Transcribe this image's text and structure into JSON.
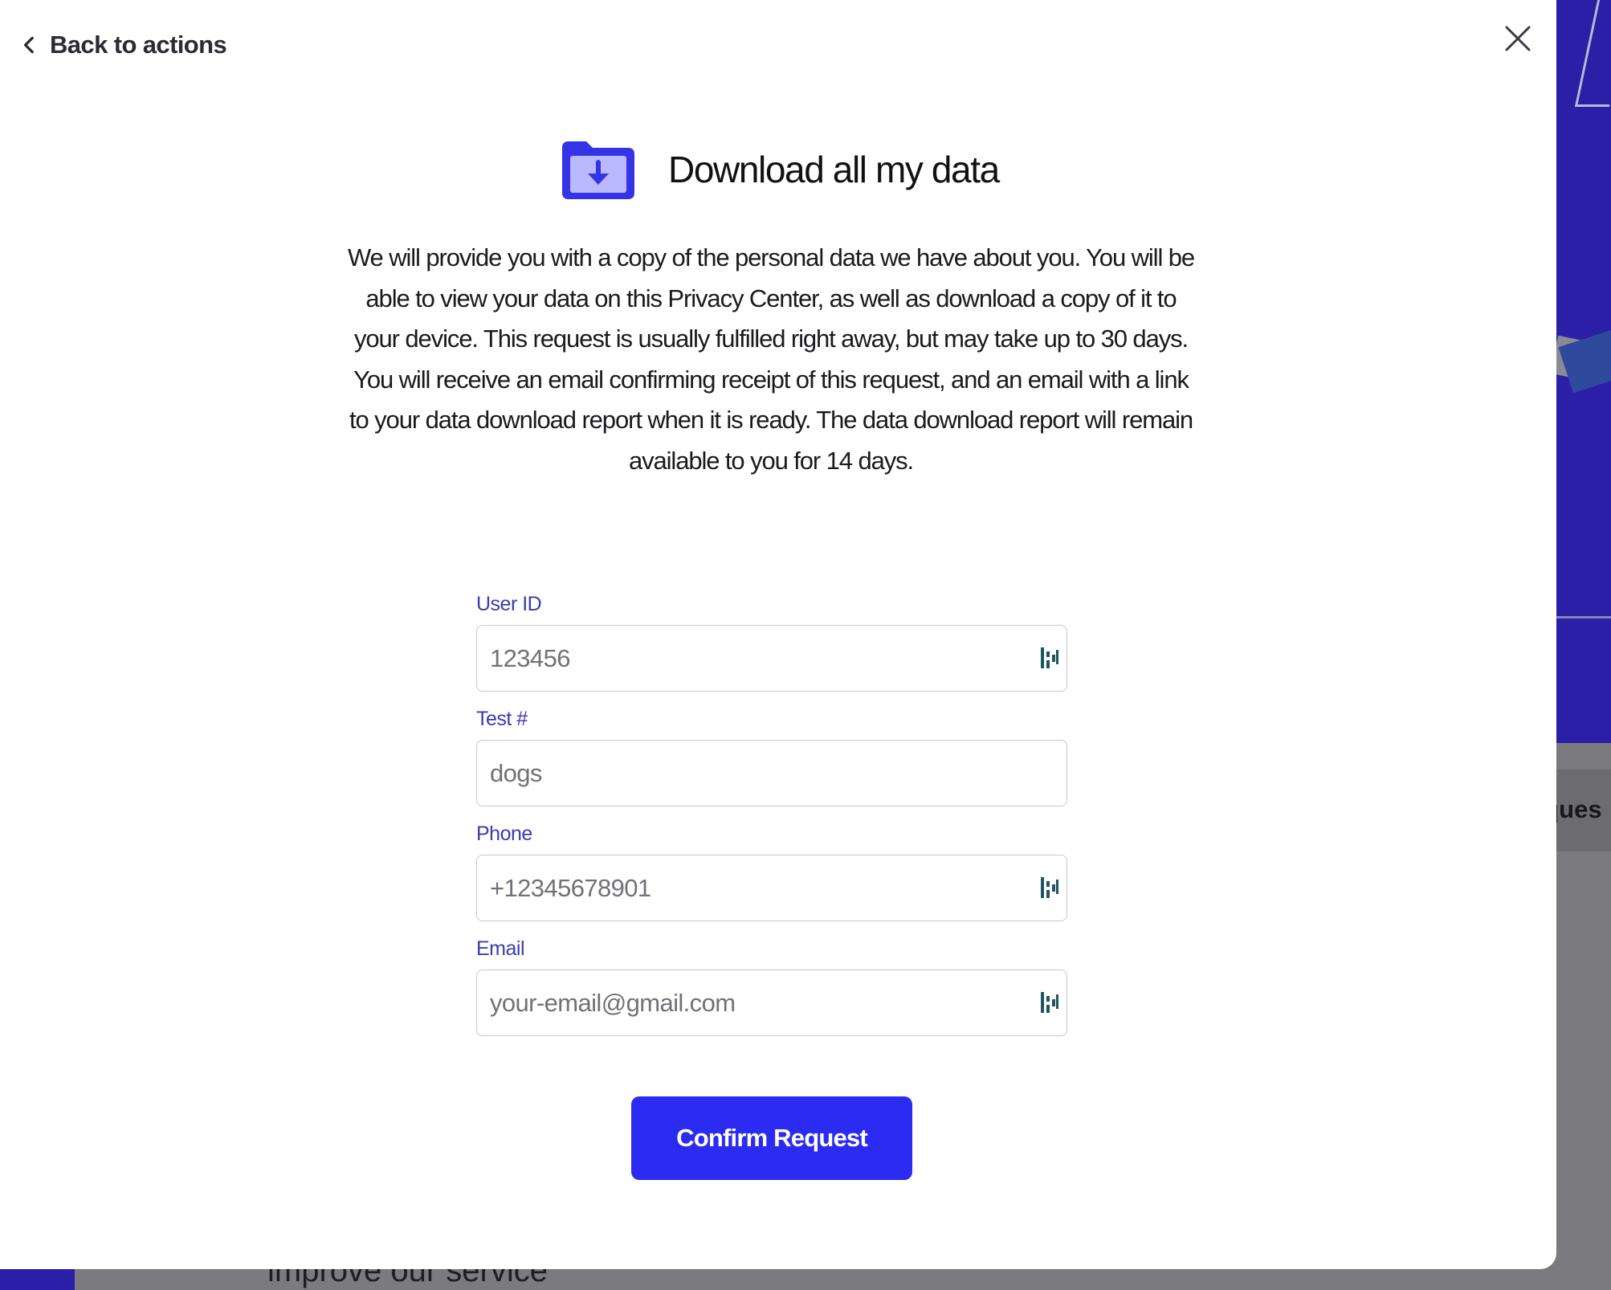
{
  "background": {
    "tab_fragment": "eques",
    "section_fragment": "improve our service"
  },
  "modal": {
    "back_label": "Back to actions",
    "title": "Download all my data",
    "description": "We will provide you with a copy of the personal data we have about you. You will be able to view your data on this Privacy Center, as well as download a copy of it to your device. This request is usually fulfilled right away, but may take up to 30 days. You will receive an email confirming receipt of this request, and an email with a link to your data download report when it is ready. The data download report will remain available to you for 14 days.",
    "fields": [
      {
        "label": "User ID",
        "placeholder": "123456",
        "has_password_manager_icon": true
      },
      {
        "label": "Test #",
        "placeholder": "dogs",
        "has_password_manager_icon": false
      },
      {
        "label": "Phone",
        "placeholder": "+12345678901",
        "has_password_manager_icon": true
      },
      {
        "label": "Email",
        "placeholder": "your-email@gmail.com",
        "has_password_manager_icon": true
      }
    ],
    "confirm_label": "Confirm Request"
  },
  "icons": {
    "back": "chevron-left-icon",
    "close": "close-icon",
    "header": "folder-download-icon",
    "field_addon": "password-manager-icon"
  },
  "colors": {
    "accent": "#2b2bf2",
    "label": "#3b3bb0",
    "hero_background": "#2a1fa6",
    "overlay": "#7b7b7f"
  }
}
